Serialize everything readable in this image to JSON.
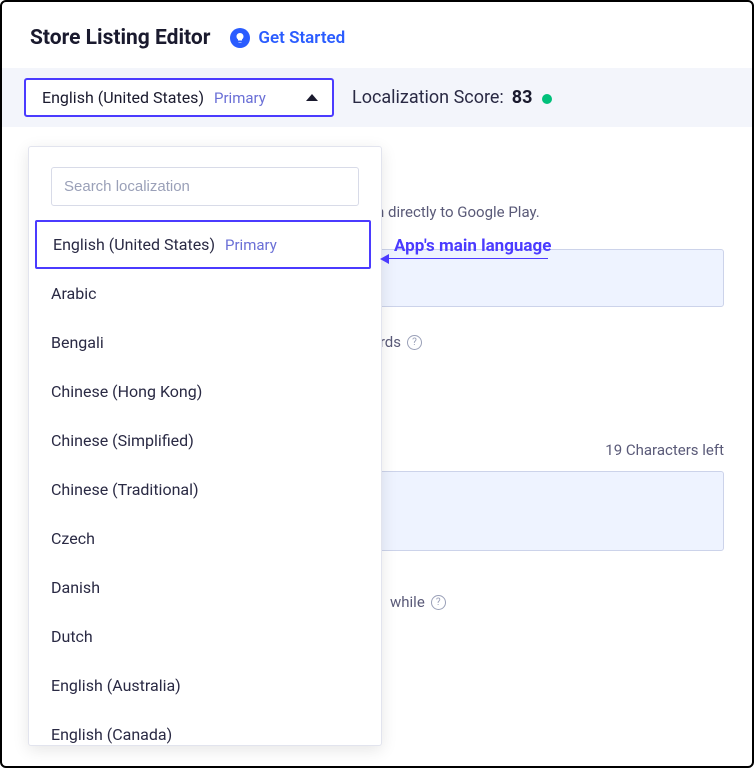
{
  "header": {
    "title": "Store Listing Editor",
    "get_started": "Get Started"
  },
  "lang_selector": {
    "current": "English (United States)",
    "primary_tag": "Primary"
  },
  "localization": {
    "label": "Localization Score:",
    "score": "83"
  },
  "content": {
    "push_text": "ush directly to Google Play.",
    "words_fragment": "words",
    "chars_left": "19 Characters left",
    "while_fragment": "while"
  },
  "dropdown": {
    "search_placeholder": "Search localization",
    "items": [
      {
        "label": "English (United States)",
        "primary": "Primary",
        "selected": true
      },
      {
        "label": "Arabic"
      },
      {
        "label": "Bengali"
      },
      {
        "label": "Chinese (Hong Kong)"
      },
      {
        "label": "Chinese (Simplified)"
      },
      {
        "label": "Chinese (Traditional)"
      },
      {
        "label": "Czech"
      },
      {
        "label": "Danish"
      },
      {
        "label": "Dutch"
      },
      {
        "label": "English (Australia)"
      },
      {
        "label": "English (Canada)"
      }
    ]
  },
  "annotation": {
    "label": "App's main language"
  }
}
